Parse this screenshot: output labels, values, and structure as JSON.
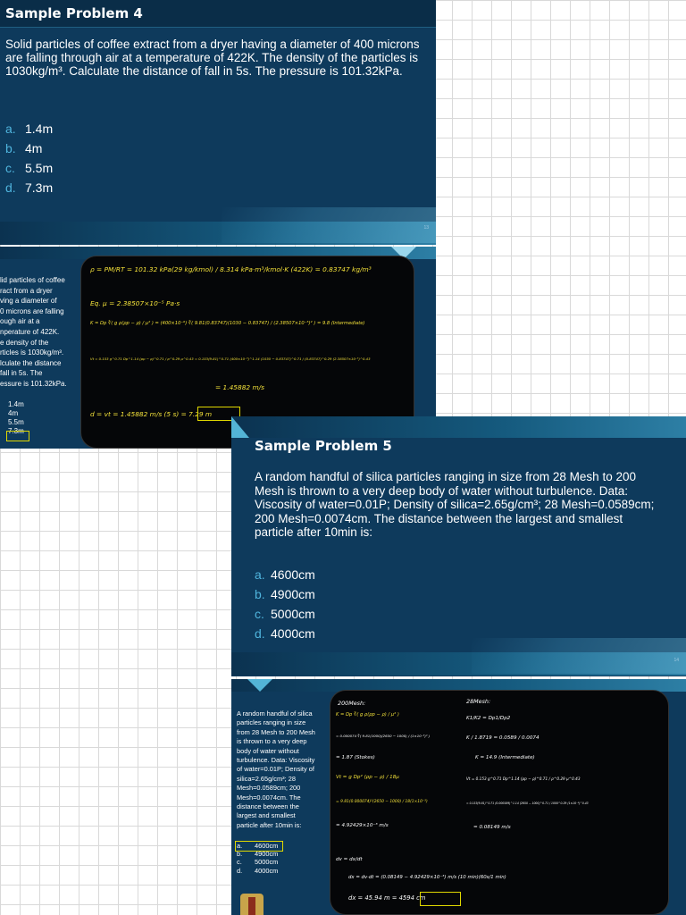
{
  "slide4": {
    "title": "Sample Problem 4",
    "problem": "Solid particles of coffee extract from a dryer having a diameter of 400 microns are falling through air at a temperature of 422K. The density of the particles is 1030kg/m³. Calculate the distance of fall in 5s. The pressure is 101.32kPa.",
    "choices": [
      {
        "letter": "a.",
        "text": "1.4m"
      },
      {
        "letter": "b.",
        "text": "4m"
      },
      {
        "letter": "c.",
        "text": "5.5m"
      },
      {
        "letter": "d.",
        "text": "7.3m"
      }
    ],
    "page_number": "13"
  },
  "solution4": {
    "problem_lines": [
      "lid particles of coffee",
      "ract from a dryer",
      "ving a diameter of",
      "0 microns are falling",
      "ough air at a",
      "nperature of 422K.",
      "e density of the",
      "rticles is 1030kg/m³.",
      "lculate the distance",
      "fall in 5s. The",
      "essure is 101.32kPa."
    ],
    "choices": [
      "1.4m",
      "4m",
      "5.5m",
      "7.3m"
    ],
    "ink": [
      "ρ = PM/RT = 101.32 kPa(29 kg/kmol) / 8.314 kPa·m³/kmol·K (422K) = 0.83747 kg/m³",
      "Eq. μ = 2.38507×10⁻⁵ Pa·s",
      "K = Dp ∛( g ρ(ρp − ρ) / μ² ) = (400×10⁻⁶) ∛( 9.81(0.83747)(1030 − 0.83747) / (2.38507×10⁻⁵)² ) = 9.8 (Intermediate)",
      "Vt = 0.153 g^0.71 Dp^1.14 (ρp − ρ)^0.71 / ρ^0.29 μ^0.43 = 0.153(9.81)^0.71 (400×10⁻⁶)^1.14 (1030 − 0.83747)^0.71 / (0.83747)^0.29 (2.38507×10⁻⁵)^0.43",
      "= 1.45882 m/s",
      "d = vt = 1.45882 m/s (5 s) = 7.29 m"
    ]
  },
  "slide5": {
    "title": "Sample Problem 5",
    "problem": "A random handful of silica particles ranging in size from 28 Mesh to 200 Mesh is thrown to a very deep body of water without turbulence. Data: Viscosity of water=0.01P; Density of silica=2.65g/cm³; 28 Mesh=0.0589cm; 200 Mesh=0.0074cm. The distance between the largest and smallest particle after 10min is:",
    "choices": [
      {
        "letter": "a.",
        "text": "4600cm"
      },
      {
        "letter": "b.",
        "text": "4900cm"
      },
      {
        "letter": "c.",
        "text": "5000cm"
      },
      {
        "letter": "d.",
        "text": "4000cm"
      }
    ],
    "page_number": "14"
  },
  "solution5": {
    "problem_lines": [
      "A random handful of silica",
      "particles ranging in size",
      "from 28 Mesh to 200 Mesh",
      "is thrown to a very deep",
      "body of water without",
      "turbulence. Data: Viscosity",
      "of water=0.01P; Density of",
      "silica=2.65g/cm³; 28",
      "Mesh=0.0589cm; 200",
      "Mesh=0.0074cm. The",
      "distance between the",
      "largest and smallest",
      "particle after 10min is:"
    ],
    "choices": [
      {
        "letter": "a.",
        "text": "4600cm"
      },
      {
        "letter": "b.",
        "text": "4900cm"
      },
      {
        "letter": "c.",
        "text": "5000cm"
      },
      {
        "letter": "d.",
        "text": "4000cm"
      }
    ],
    "ink_left": [
      "200Mesh:",
      "K = Dp ∛( g ρ(ρp − ρ) / μ² )",
      "= 0.000074 ∛( 9.81(1000)(2650 − 1000) / (1×10⁻³)² )",
      "= 1.87 (Stokes)",
      "Vt = g Dp² (ρp − ρ) / 18μ",
      "= 9.81(0.000074)²(2650 − 1000) / 18(1×10⁻³)",
      "= 4.92429×10⁻³ m/s",
      "dv = dx/dt",
      "dx = dv·dt = (0.08149 − 4.92429×10⁻³) m/s (10 min)(60s/1 min)",
      "dx = 45.94 m = 4594 cm"
    ],
    "ink_right": [
      "28Mesh:",
      "K1/K2 = Dp1/Dp2",
      "K / 1.8719 = 0.0589 / 0.0074",
      "K = 14.9 (Intermediate)",
      "Vt = 0.153 g^0.71 Dp^1.14 (ρp − ρ)^0.71 / ρ^0.29 μ^0.43",
      "= 0.153(9.81)^0.71 (0.000589)^1.14 (2650 − 1000)^0.71 / 1000^0.29 (1×10⁻³)^0.43",
      "= 0.08149 m/s"
    ]
  }
}
